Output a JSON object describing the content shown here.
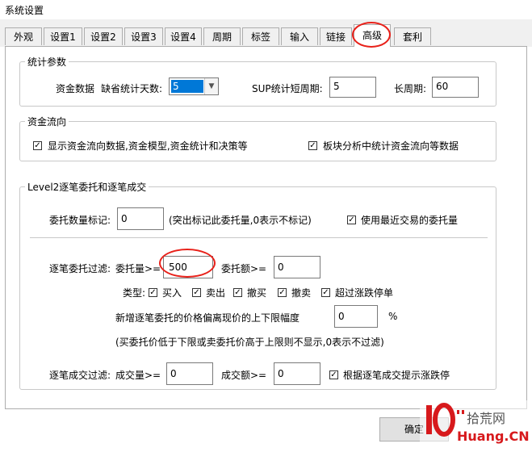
{
  "window": {
    "title": "系统设置"
  },
  "tabs": [
    "外观",
    "设置1",
    "设置2",
    "设置3",
    "设置4",
    "周期",
    "标签",
    "输入",
    "链接",
    "高级",
    "套利"
  ],
  "active_tab": "高级",
  "stats": {
    "group_title": "统计参数",
    "fund_data_label": "资金数据",
    "default_days_label": "缺省统计天数:",
    "default_days_value": "5",
    "sup_short_label": "SUP统计短周期:",
    "sup_short_value": "5",
    "long_period_label": "长周期:",
    "long_period_value": "60"
  },
  "fund_flow": {
    "group_title": "资金流向",
    "cb1_label": "显示资金流向数据,资金模型,资金统计和决策等",
    "cb1_checked": true,
    "cb2_label": "板块分析中统计资金流向等数据",
    "cb2_checked": true
  },
  "level2": {
    "group_title": "Level2逐笔委托和逐笔成交",
    "order_mark_label": "委托数量标记:",
    "order_mark_value": "0",
    "order_mark_hint": "(突出标记此委托量,0表示不标记)",
    "recent_trade_label": "使用最近交易的委托量",
    "recent_trade_checked": true,
    "filter_label": "逐笔委托过滤:",
    "order_qty_label": "委托量>=",
    "order_qty_value": "500",
    "order_amt_label": "委托额>=",
    "order_amt_value": "0",
    "type_label": "类型:",
    "types": [
      {
        "label": "买入",
        "checked": true
      },
      {
        "label": "卖出",
        "checked": true
      },
      {
        "label": "撤买",
        "checked": true
      },
      {
        "label": "撤卖",
        "checked": true
      },
      {
        "label": "超过涨跌停单",
        "checked": true
      }
    ],
    "price_dev_label": "新增逐笔委托的价格偏离现价的上下限幅度",
    "price_dev_value": "0",
    "price_dev_unit": "%",
    "price_dev_hint": "(买委托价低于下限或卖委托价高于上限则不显示,0表示不过滤)",
    "trade_filter_label": "逐笔成交过滤:",
    "trade_qty_label": "成交量>=",
    "trade_qty_value": "0",
    "trade_amt_label": "成交额>=",
    "trade_amt_value": "0",
    "limit_hint_label": "根据逐笔成交提示涨跌停",
    "limit_hint_checked": true
  },
  "buttons": {
    "ok_label": "确定"
  },
  "watermark": {
    "brand": "拾荒网",
    "domain": "Huang.CN",
    "number": "10"
  },
  "colors": {
    "highlight_ring": "#e8211a",
    "selection": "#0078d7"
  }
}
